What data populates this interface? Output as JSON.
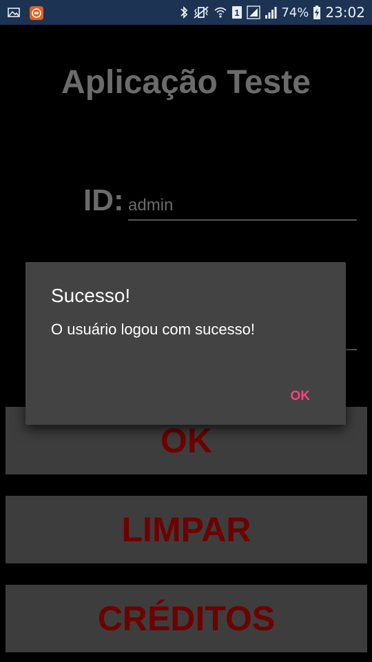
{
  "status_bar": {
    "icons_left": [
      "image-notification-icon",
      "app-notification-icon"
    ],
    "icons_right": [
      "bluetooth-icon",
      "vibrate-icon",
      "wifi-icon",
      "sim-1-icon",
      "signal-icon",
      "signal-icon"
    ],
    "battery_percent": "74%",
    "time": "23:02"
  },
  "app": {
    "title": "Aplicação Teste",
    "id_label": "ID:",
    "id_value": "admin",
    "buttons": {
      "ok": "OK",
      "limpar": "LIMPAR",
      "creditos": "CRÉDITOS"
    }
  },
  "dialog": {
    "title": "Sucesso!",
    "message": "O usuário logou com sucesso!",
    "ok_label": "OK"
  },
  "colors": {
    "status_bar_bg": "#1c3354",
    "app_background": "#000000",
    "button_bg": "#3d3d3d",
    "button_text": "#6e0000",
    "dialog_bg": "#434343",
    "dialog_accent": "#ff4081"
  }
}
